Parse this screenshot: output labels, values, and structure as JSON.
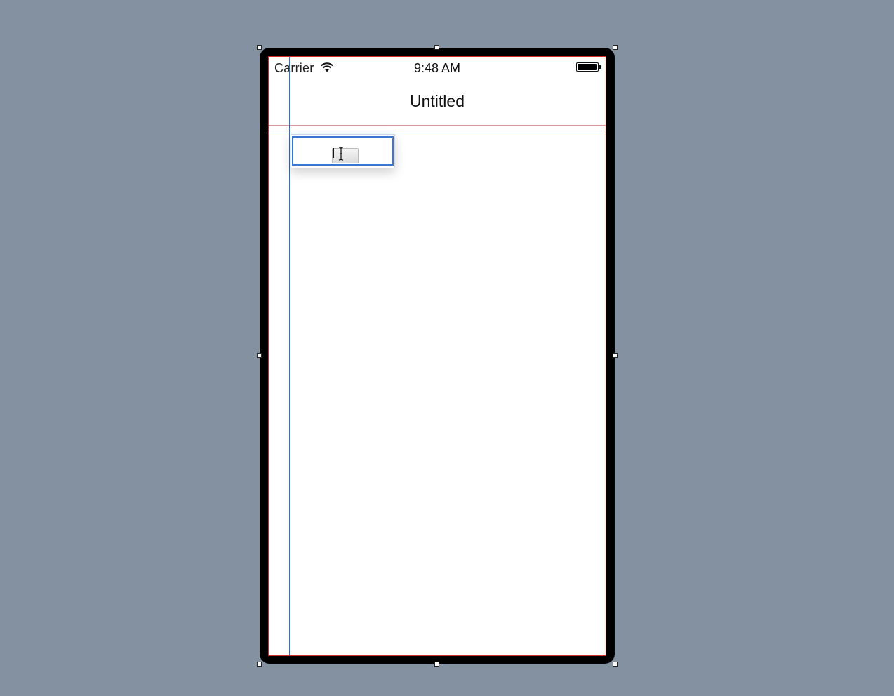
{
  "status_bar": {
    "carrier": "Carrier",
    "time": "9:48 AM",
    "wifi_icon": "wifi-icon",
    "battery_icon": "battery-icon",
    "battery_level": 1.0
  },
  "nav_bar": {
    "title": "Untitled"
  },
  "text_field": {
    "value": "",
    "cursor_icon": "i-beam-cursor-icon"
  },
  "colors": {
    "canvas_background": "#8491a0",
    "device_frame": "#000000",
    "guide_line": "#2a6bd8",
    "bounds_outline": "#d42a2a"
  }
}
